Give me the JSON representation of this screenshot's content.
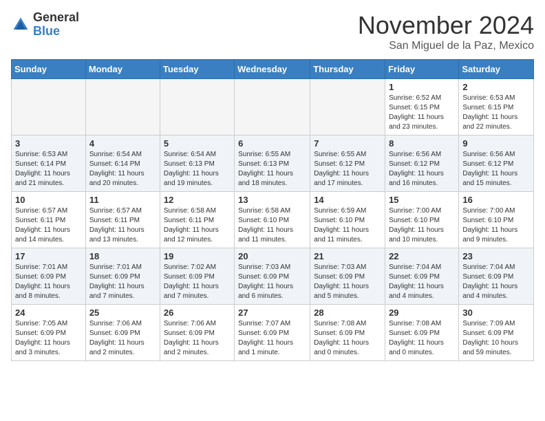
{
  "header": {
    "logo_general": "General",
    "logo_blue": "Blue",
    "month_title": "November 2024",
    "location": "San Miguel de la Paz, Mexico"
  },
  "weekdays": [
    "Sunday",
    "Monday",
    "Tuesday",
    "Wednesday",
    "Thursday",
    "Friday",
    "Saturday"
  ],
  "weeks": [
    [
      {
        "day": "",
        "info": ""
      },
      {
        "day": "",
        "info": ""
      },
      {
        "day": "",
        "info": ""
      },
      {
        "day": "",
        "info": ""
      },
      {
        "day": "",
        "info": ""
      },
      {
        "day": "1",
        "info": "Sunrise: 6:52 AM\nSunset: 6:15 PM\nDaylight: 11 hours\nand 23 minutes."
      },
      {
        "day": "2",
        "info": "Sunrise: 6:53 AM\nSunset: 6:15 PM\nDaylight: 11 hours\nand 22 minutes."
      }
    ],
    [
      {
        "day": "3",
        "info": "Sunrise: 6:53 AM\nSunset: 6:14 PM\nDaylight: 11 hours\nand 21 minutes."
      },
      {
        "day": "4",
        "info": "Sunrise: 6:54 AM\nSunset: 6:14 PM\nDaylight: 11 hours\nand 20 minutes."
      },
      {
        "day": "5",
        "info": "Sunrise: 6:54 AM\nSunset: 6:13 PM\nDaylight: 11 hours\nand 19 minutes."
      },
      {
        "day": "6",
        "info": "Sunrise: 6:55 AM\nSunset: 6:13 PM\nDaylight: 11 hours\nand 18 minutes."
      },
      {
        "day": "7",
        "info": "Sunrise: 6:55 AM\nSunset: 6:12 PM\nDaylight: 11 hours\nand 17 minutes."
      },
      {
        "day": "8",
        "info": "Sunrise: 6:56 AM\nSunset: 6:12 PM\nDaylight: 11 hours\nand 16 minutes."
      },
      {
        "day": "9",
        "info": "Sunrise: 6:56 AM\nSunset: 6:12 PM\nDaylight: 11 hours\nand 15 minutes."
      }
    ],
    [
      {
        "day": "10",
        "info": "Sunrise: 6:57 AM\nSunset: 6:11 PM\nDaylight: 11 hours\nand 14 minutes."
      },
      {
        "day": "11",
        "info": "Sunrise: 6:57 AM\nSunset: 6:11 PM\nDaylight: 11 hours\nand 13 minutes."
      },
      {
        "day": "12",
        "info": "Sunrise: 6:58 AM\nSunset: 6:11 PM\nDaylight: 11 hours\nand 12 minutes."
      },
      {
        "day": "13",
        "info": "Sunrise: 6:58 AM\nSunset: 6:10 PM\nDaylight: 11 hours\nand 11 minutes."
      },
      {
        "day": "14",
        "info": "Sunrise: 6:59 AM\nSunset: 6:10 PM\nDaylight: 11 hours\nand 11 minutes."
      },
      {
        "day": "15",
        "info": "Sunrise: 7:00 AM\nSunset: 6:10 PM\nDaylight: 11 hours\nand 10 minutes."
      },
      {
        "day": "16",
        "info": "Sunrise: 7:00 AM\nSunset: 6:10 PM\nDaylight: 11 hours\nand 9 minutes."
      }
    ],
    [
      {
        "day": "17",
        "info": "Sunrise: 7:01 AM\nSunset: 6:09 PM\nDaylight: 11 hours\nand 8 minutes."
      },
      {
        "day": "18",
        "info": "Sunrise: 7:01 AM\nSunset: 6:09 PM\nDaylight: 11 hours\nand 7 minutes."
      },
      {
        "day": "19",
        "info": "Sunrise: 7:02 AM\nSunset: 6:09 PM\nDaylight: 11 hours\nand 7 minutes."
      },
      {
        "day": "20",
        "info": "Sunrise: 7:03 AM\nSunset: 6:09 PM\nDaylight: 11 hours\nand 6 minutes."
      },
      {
        "day": "21",
        "info": "Sunrise: 7:03 AM\nSunset: 6:09 PM\nDaylight: 11 hours\nand 5 minutes."
      },
      {
        "day": "22",
        "info": "Sunrise: 7:04 AM\nSunset: 6:09 PM\nDaylight: 11 hours\nand 4 minutes."
      },
      {
        "day": "23",
        "info": "Sunrise: 7:04 AM\nSunset: 6:09 PM\nDaylight: 11 hours\nand 4 minutes."
      }
    ],
    [
      {
        "day": "24",
        "info": "Sunrise: 7:05 AM\nSunset: 6:09 PM\nDaylight: 11 hours\nand 3 minutes."
      },
      {
        "day": "25",
        "info": "Sunrise: 7:06 AM\nSunset: 6:09 PM\nDaylight: 11 hours\nand 2 minutes."
      },
      {
        "day": "26",
        "info": "Sunrise: 7:06 AM\nSunset: 6:09 PM\nDaylight: 11 hours\nand 2 minutes."
      },
      {
        "day": "27",
        "info": "Sunrise: 7:07 AM\nSunset: 6:09 PM\nDaylight: 11 hours\nand 1 minute."
      },
      {
        "day": "28",
        "info": "Sunrise: 7:08 AM\nSunset: 6:09 PM\nDaylight: 11 hours\nand 0 minutes."
      },
      {
        "day": "29",
        "info": "Sunrise: 7:08 AM\nSunset: 6:09 PM\nDaylight: 11 hours\nand 0 minutes."
      },
      {
        "day": "30",
        "info": "Sunrise: 7:09 AM\nSunset: 6:09 PM\nDaylight: 10 hours\nand 59 minutes."
      }
    ]
  ]
}
